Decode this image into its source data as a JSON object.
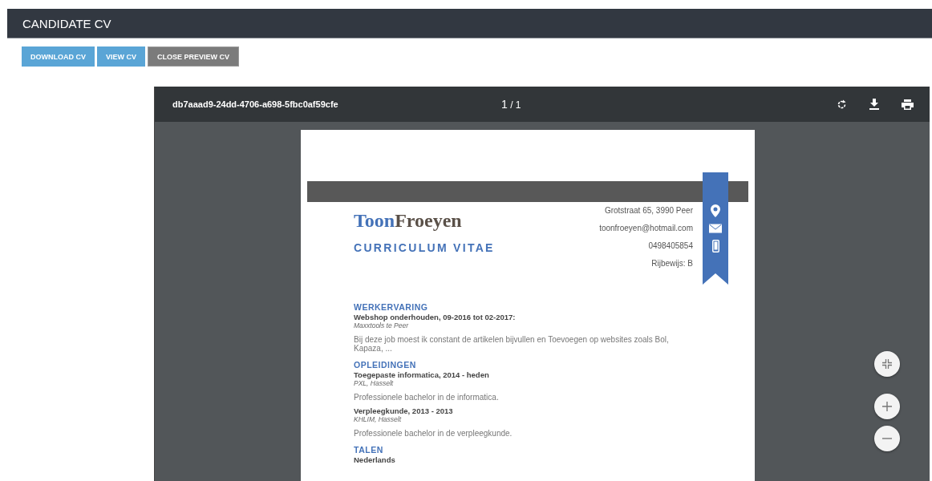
{
  "header": {
    "title": "CANDIDATE CV"
  },
  "buttons": [
    {
      "label": "DOWNLOAD CV",
      "kind": "primary"
    },
    {
      "label": "VIEW CV",
      "kind": "primary"
    },
    {
      "label": "CLOSE PREVIEW CV",
      "kind": "secondary"
    }
  ],
  "viewer": {
    "file_name": "db7aaad9-24dd-4706-a698-5fbc0af59cfe",
    "page_current": "1",
    "page_total": "/ 1"
  },
  "document": {
    "name_first": "Toon",
    "name_last": "Froeyen",
    "subtitle": "CURRICULUM VITAE",
    "contacts": [
      {
        "text": "Grotstraat 65, 3990 Peer",
        "kind": "address"
      },
      {
        "text": "toonfroeyen@hotmail.com",
        "kind": "email"
      },
      {
        "text": "0498405854",
        "kind": "phone"
      },
      {
        "text": "Rijbewijs: B",
        "kind": "plain"
      }
    ],
    "sections": [
      {
        "title": "WERKERVARING",
        "entries": [
          {
            "kind": "heading",
            "text": "Webshop onderhouden, 09-2016 tot 02-2017:"
          },
          {
            "kind": "place",
            "text": "Maxxtools te Peer"
          },
          {
            "kind": "text",
            "text": "Bij deze job moest ik constant de artikelen bijvullen en Toevoegen op websites zoals Bol, Kapaza, ..."
          }
        ]
      },
      {
        "title": "OPLEIDINGEN",
        "entries": [
          {
            "kind": "heading",
            "text": "Toegepaste informatica, 2014 - heden"
          },
          {
            "kind": "place",
            "text": "PXL, Hasselt"
          },
          {
            "kind": "text",
            "text": "Professionele bachelor in de informatica."
          },
          {
            "kind": "heading",
            "text": "Verpleegkunde, 2013 - 2013"
          },
          {
            "kind": "place",
            "text": "KHLIM, Hasselt"
          },
          {
            "kind": "text",
            "text": "Professionele bachelor in de verpleegkunde."
          }
        ]
      },
      {
        "title": "TALEN",
        "entries": [
          {
            "kind": "heading",
            "text": "Nederlands"
          }
        ]
      }
    ]
  }
}
